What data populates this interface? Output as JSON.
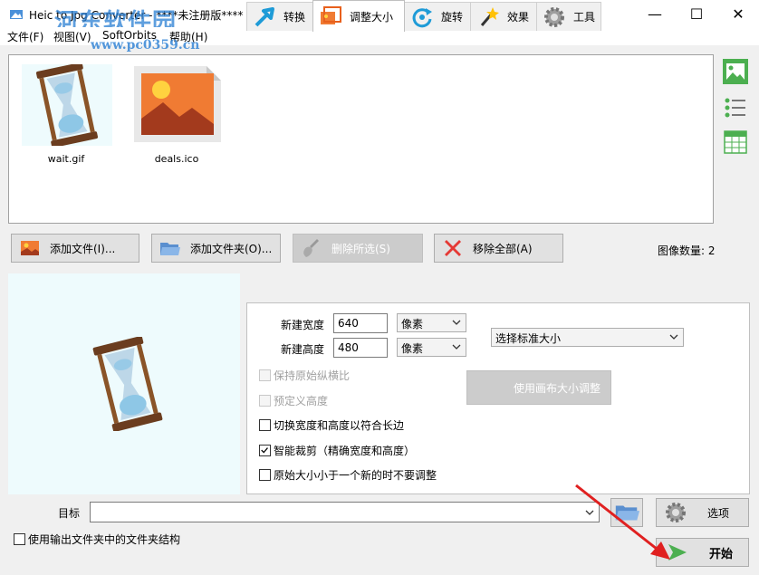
{
  "window": {
    "title": "Heic to Jpg Converter - ****未注册版****",
    "watermark": "河东软件园",
    "watermark_url": "www.pc0359.cn",
    "minimize": "—",
    "maximize": "☐",
    "close": "✕"
  },
  "menu": {
    "items": [
      "文件(F)",
      "视图(V)",
      "SoftOrbits",
      "帮助(H)"
    ]
  },
  "files": [
    {
      "name": "wait.gif",
      "icon": "hourglass-icon"
    },
    {
      "name": "deals.ico",
      "icon": "landscape-image-icon"
    }
  ],
  "view_modes": [
    "thumbnail-view-icon",
    "list-view-icon",
    "table-view-icon"
  ],
  "actions": {
    "add_files": "添加文件(I)...",
    "add_folder": "添加文件夹(O)...",
    "remove_selected": "删除所选(S)",
    "remove_all": "移除全部(A)",
    "count_label": "图像数量: 2"
  },
  "tabs": [
    {
      "label": "转换",
      "icon": "convert-arrow-icon"
    },
    {
      "label": "调整大小",
      "icon": "resize-icon",
      "active": true
    },
    {
      "label": "旋转",
      "icon": "rotate-icon"
    },
    {
      "label": "效果",
      "icon": "magic-wand-icon"
    },
    {
      "label": "工具",
      "icon": "gear-icon"
    }
  ],
  "resize": {
    "new_width_label": "新建宽度",
    "new_width_value": "640",
    "new_height_label": "新建高度",
    "new_height_value": "480",
    "unit_width": "像素",
    "unit_height": "像素",
    "standard_size": "选择标准大小",
    "keep_aspect": "保持原始纵横比",
    "predefined_height": "预定义高度",
    "swap_dims": "切换宽度和高度以符合长边",
    "smart_crop": "智能裁剪（精确宽度和高度）",
    "no_upscale": "原始大小小于一个新的时不要调整",
    "canvas_resize": "使用画布大小调整"
  },
  "output": {
    "target_label": "目标",
    "target_value": "",
    "options": "选项",
    "start": "开始",
    "keep_structure": "使用输出文件夹中的文件夹结构"
  },
  "colors": {
    "accent_blue": "#2a7fd4",
    "start_green": "#4caf50",
    "arrow_red": "#e02020"
  }
}
